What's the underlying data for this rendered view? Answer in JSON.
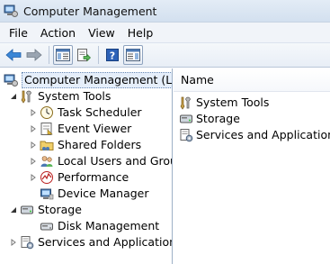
{
  "window": {
    "title": "Computer Management",
    "icon": "computer-management-icon"
  },
  "menu": [
    "File",
    "Action",
    "View",
    "Help"
  ],
  "toolbar": {
    "buttons": [
      "back-arrow-icon",
      "forward-arrow-icon",
      "show-hide-console-tree-icon",
      "export-list-icon",
      "help-icon",
      "show-hide-action-pane-icon"
    ]
  },
  "tree": {
    "root": "Computer Management (Local",
    "system_tools": "System Tools",
    "task_scheduler": "Task Scheduler",
    "event_viewer": "Event Viewer",
    "shared_folders": "Shared Folders",
    "local_users": "Local Users and Groups",
    "performance": "Performance",
    "device_manager": "Device Manager",
    "storage": "Storage",
    "disk_management": "Disk Management",
    "services_apps": "Services and Applications"
  },
  "list": {
    "column_name": "Name",
    "items": [
      "System Tools",
      "Storage",
      "Services and Applications"
    ]
  },
  "colors": {
    "accent": "#3a6ea5",
    "selection": "#e5eefa"
  }
}
